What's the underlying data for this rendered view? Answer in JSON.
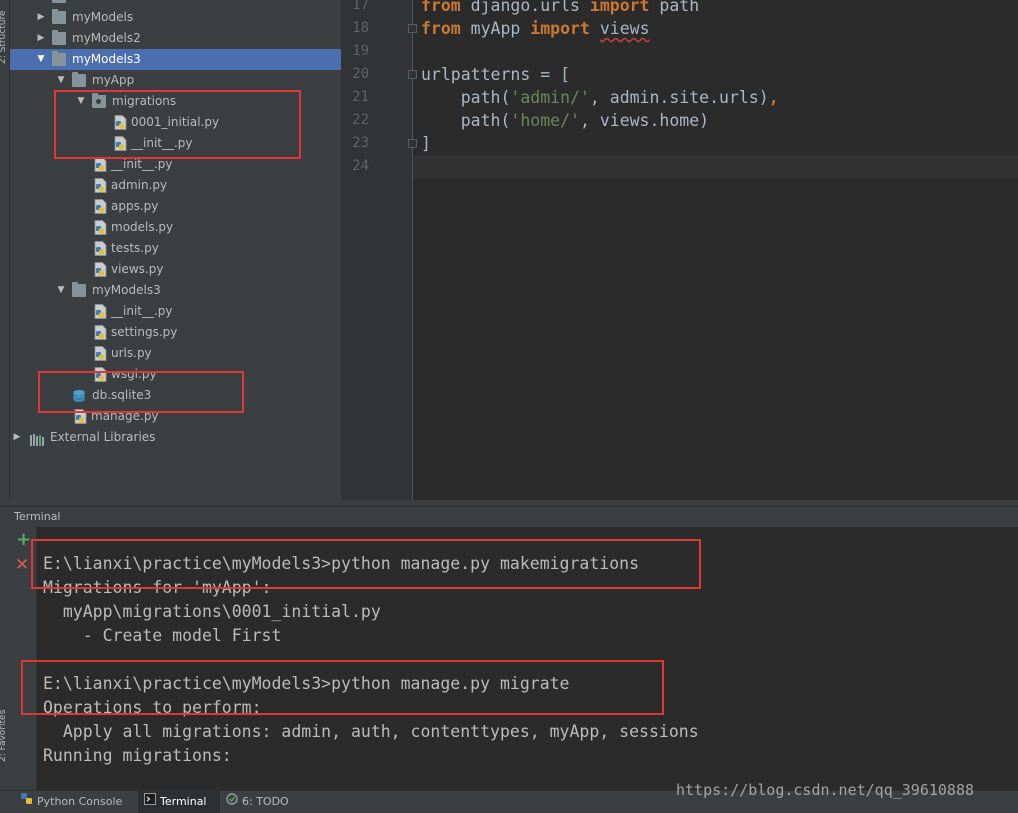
{
  "left_strip": {
    "structure_tab": "2: Structure",
    "favorites_tab": "2: Favorites"
  },
  "project_tree": {
    "items": [
      {
        "label": "...",
        "depth": 0,
        "type": "folder",
        "expanded": false
      },
      {
        "label": "myModels",
        "depth": 0,
        "type": "folder",
        "expanded": false
      },
      {
        "label": "myModels2",
        "depth": 0,
        "type": "folder",
        "expanded": false
      },
      {
        "label": "myModels3",
        "depth": 0,
        "type": "folder",
        "expanded": true,
        "selected": true
      },
      {
        "label": "myApp",
        "depth": 1,
        "type": "folder",
        "expanded": true
      },
      {
        "label": "migrations",
        "depth": 2,
        "type": "package",
        "expanded": true
      },
      {
        "label": "0001_initial.py",
        "depth": 3,
        "type": "py"
      },
      {
        "label": "__init__.py",
        "depth": 3,
        "type": "py"
      },
      {
        "label": "__init__.py",
        "depth": 2,
        "type": "py"
      },
      {
        "label": "admin.py",
        "depth": 2,
        "type": "py"
      },
      {
        "label": "apps.py",
        "depth": 2,
        "type": "py"
      },
      {
        "label": "models.py",
        "depth": 2,
        "type": "py"
      },
      {
        "label": "tests.py",
        "depth": 2,
        "type": "py"
      },
      {
        "label": "views.py",
        "depth": 2,
        "type": "py"
      },
      {
        "label": "myModels3",
        "depth": 1,
        "type": "folder",
        "expanded": true
      },
      {
        "label": "__init__.py",
        "depth": 2,
        "type": "py"
      },
      {
        "label": "settings.py",
        "depth": 2,
        "type": "py"
      },
      {
        "label": "urls.py",
        "depth": 2,
        "type": "py"
      },
      {
        "label": "wsgi.py",
        "depth": 2,
        "type": "py"
      },
      {
        "label": "db.sqlite3",
        "depth": 1,
        "type": "db"
      },
      {
        "label": "manage.py",
        "depth": 1,
        "type": "py"
      },
      {
        "label": "External Libraries",
        "depth": -1,
        "type": "lib",
        "expanded": false
      }
    ]
  },
  "editor": {
    "lines": [
      {
        "num": "17",
        "tokens": [
          {
            "t": "from",
            "c": "kw"
          },
          {
            "t": " django.urls ",
            "c": "ident"
          },
          {
            "t": "import",
            "c": "kw"
          },
          {
            "t": " path",
            "c": "ident"
          }
        ]
      },
      {
        "num": "18",
        "tokens": [
          {
            "t": "from",
            "c": "kw"
          },
          {
            "t": " myApp ",
            "c": "ident"
          },
          {
            "t": "import",
            "c": "kw"
          },
          {
            "t": " ",
            "c": "ident"
          },
          {
            "t": "views",
            "c": "ident ul"
          }
        ]
      },
      {
        "num": "19",
        "tokens": []
      },
      {
        "num": "20",
        "tokens": [
          {
            "t": "urlpatterns = [",
            "c": "ident"
          }
        ]
      },
      {
        "num": "21",
        "tokens": [
          {
            "t": "    path(",
            "c": "ident"
          },
          {
            "t": "'admin/'",
            "c": "str"
          },
          {
            "t": ", admin.site.urls)",
            "c": "ident"
          },
          {
            "t": ",",
            "c": "kw"
          }
        ]
      },
      {
        "num": "22",
        "tokens": [
          {
            "t": "    path(",
            "c": "ident"
          },
          {
            "t": "'home/'",
            "c": "str"
          },
          {
            "t": ", views.home)",
            "c": "ident"
          }
        ]
      },
      {
        "num": "23",
        "tokens": [
          {
            "t": "]",
            "c": "ident"
          }
        ]
      },
      {
        "num": "24",
        "tokens": []
      }
    ]
  },
  "terminal": {
    "title": "Terminal",
    "add_icon": "plus-icon",
    "close_icon": "close-icon",
    "lines": [
      "E:\\lianxi\\practice\\myModels3>python manage.py makemigrations",
      "Migrations for 'myApp':",
      "  myApp\\migrations\\0001_initial.py",
      "    - Create model First",
      "",
      "E:\\lianxi\\practice\\myModels3>python manage.py migrate",
      "Operations to perform:",
      "  Apply all migrations: admin, auth, contenttypes, myApp, sessions",
      "Running migrations:"
    ]
  },
  "bottom_bar": {
    "tabs": [
      {
        "label": "Python Console",
        "icon": "python-console-icon",
        "active": false
      },
      {
        "label": "Terminal",
        "icon": "terminal-icon",
        "active": true
      },
      {
        "label": "6: TODO",
        "icon": "todo-icon",
        "active": false
      }
    ]
  },
  "watermark": "https://blog.csdn.net/qq_39610888",
  "colors": {
    "keyword": "#cc7832",
    "string": "#6a8759",
    "text": "#a9b7c6",
    "selection": "#4b6eaf",
    "highlight_box": "#e03636"
  }
}
